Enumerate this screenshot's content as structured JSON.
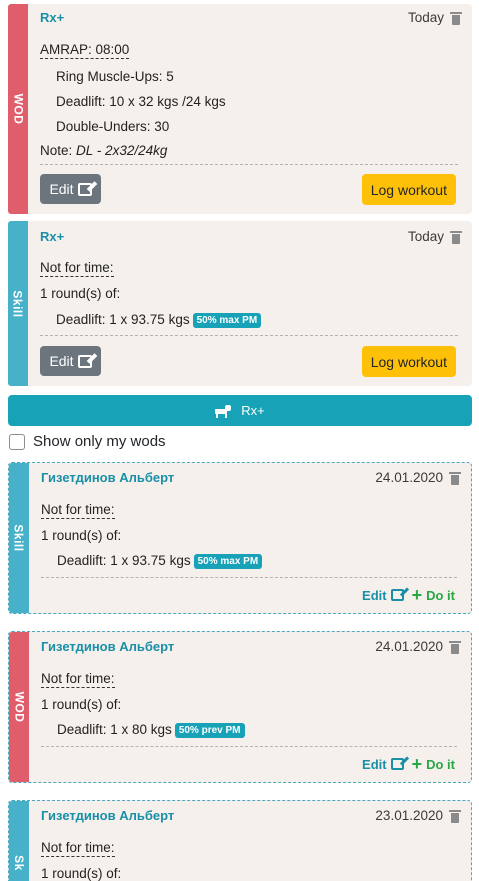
{
  "cards_top": [
    {
      "type": "WOD",
      "author": "Rx+",
      "date": "Today",
      "title": "AMRAP: 08:00",
      "items": [
        "Ring Muscle-Ups: 5",
        "Deadlift: 10 x 32 kgs /24 kgs",
        "Double-Unders: 30"
      ],
      "note_label": "Note:",
      "note_text": "DL - 2x32/24kg",
      "edit_label": "Edit",
      "log_label": "Log workout"
    },
    {
      "type": "Skill",
      "author": "Rx+",
      "date": "Today",
      "title": "Not for time:",
      "rounds": "1 round(s) of:",
      "item": "Deadlift: 1 x 93.75 kgs",
      "badge": "50% max PM",
      "edit_label": "Edit",
      "log_label": "Log workout"
    }
  ],
  "rx_button": {
    "label": "Rx+",
    "icon": "dog-icon"
  },
  "filter": {
    "label": "Show only my wods",
    "checked": false
  },
  "cards_list": [
    {
      "type": "Skill",
      "author": "Гизетдинов Альберт",
      "date": "24.01.2020",
      "title": "Not for time:",
      "rounds": "1 round(s) of:",
      "item": "Deadlift: 1 x 93.75 kgs",
      "badge": "50% max PM",
      "edit_label": "Edit",
      "do_label": "Do it"
    },
    {
      "type": "WOD",
      "author": "Гизетдинов Альберт",
      "date": "24.01.2020",
      "title": "Not for time:",
      "rounds": "1 round(s) of:",
      "item": "Deadlift: 1 x 80 kgs",
      "badge": "50% prev PM",
      "edit_label": "Edit",
      "do_label": "Do it"
    },
    {
      "type": "Sk",
      "author": "Гизетдинов Альберт",
      "date": "23.01.2020",
      "title": "Not for time:",
      "rounds": "1 round(s) of:"
    }
  ],
  "colors": {
    "wod": "#e05d6c",
    "skill": "#47b1c9",
    "primary": "#17a2b8",
    "warning": "#ffc107",
    "success": "#28a745"
  }
}
